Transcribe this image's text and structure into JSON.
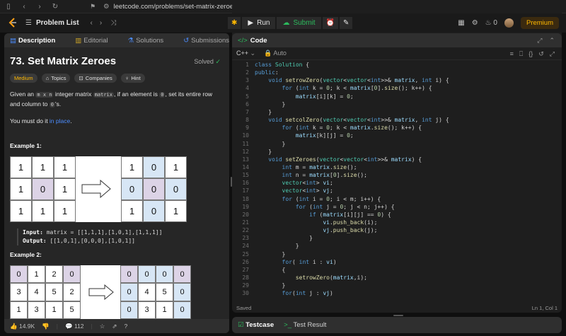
{
  "browser": {
    "url": "leetcode.com/problems/set-matrix-zeroes/description/",
    "badge": "5"
  },
  "header": {
    "problem_list": "Problem List",
    "run": "Run",
    "submit": "Submit",
    "streak": "0",
    "premium": "Premium"
  },
  "left": {
    "tabs": [
      {
        "label": "Description"
      },
      {
        "label": "Editorial"
      },
      {
        "label": "Solutions"
      },
      {
        "label": "Submissions"
      }
    ],
    "title": "73. Set Matrix Zeroes",
    "solved": "Solved",
    "chips": [
      "Medium",
      "Topics",
      "Companies",
      "Hint"
    ],
    "desc_parts": {
      "p1": "Given an ",
      "c1": "m x n",
      "p2": " integer matrix ",
      "c2": "matrix",
      "p3": ", if an element is ",
      "c3": "0",
      "p4": ", set its entire row and column to ",
      "c4": "0",
      "p5": "'s."
    },
    "must_pre": "You must do it ",
    "must_link": "in place",
    "must_post": ".",
    "ex1_title": "Example 1:",
    "ex1_in_label": "Input:",
    "ex1_in": "matrix = [[1,1,1],[1,0,1],[1,1,1]]",
    "ex1_out_label": "Output:",
    "ex1_out": "[[1,0,1],[0,0,0],[1,0,1]]",
    "ex2_title": "Example 2:",
    "ex1_before": [
      [
        "1",
        "1",
        "1"
      ],
      [
        "1",
        "0",
        "1"
      ],
      [
        "1",
        "1",
        "1"
      ]
    ],
    "ex1_after": [
      [
        "1",
        "0",
        "1"
      ],
      [
        "0",
        "0",
        "0"
      ],
      [
        "1",
        "0",
        "1"
      ]
    ],
    "ex2_before": [
      [
        "0",
        "1",
        "2",
        "0"
      ],
      [
        "3",
        "4",
        "5",
        "2"
      ],
      [
        "1",
        "3",
        "1",
        "5"
      ]
    ],
    "ex2_after": [
      [
        "0",
        "0",
        "0",
        "0"
      ],
      [
        "0",
        "4",
        "5",
        "0"
      ],
      [
        "0",
        "3",
        "1",
        "0"
      ]
    ],
    "likes": "14.9K",
    "comments": "112"
  },
  "right": {
    "tab_label": "Code",
    "lang": "C++",
    "mode": "Auto",
    "status_left": "Saved",
    "status_right": "Ln 1, Col 1",
    "lines": [
      "class Solution {",
      "public:",
      "    void setrowZero(vector<vector<int>>& matrix, int i) {",
      "        for (int k = 0; k < matrix[0].size(); k++) {",
      "            matrix[i][k] = 0;",
      "        }",
      "    }",
      "    void setcolZero(vector<vector<int>>& matrix, int j) {",
      "        for (int k = 0; k < matrix.size(); k++) {",
      "            matrix[k][j] = 0;",
      "        }",
      "    }",
      "    void setZeroes(vector<vector<int>>& matrix) {",
      "        int m = matrix.size();",
      "        int n = matrix[0].size();",
      "        vector<int> vi;",
      "        vector<int> vj;",
      "        for (int i = 0; i < m; i++) {",
      "            for (int j = 0; j < n; j++) {",
      "                if (matrix[i][j] == 0) {",
      "                    vi.push_back(i);",
      "                    vj.push_back(j);",
      "                }",
      "            }",
      "        }",
      "        for( int i : vi)",
      "        {",
      "            setrowZero(matrix,i);",
      "        }",
      "        for(int j : vj)"
    ]
  },
  "testbar": {
    "testcase": "Testcase",
    "result": "Test Result"
  }
}
